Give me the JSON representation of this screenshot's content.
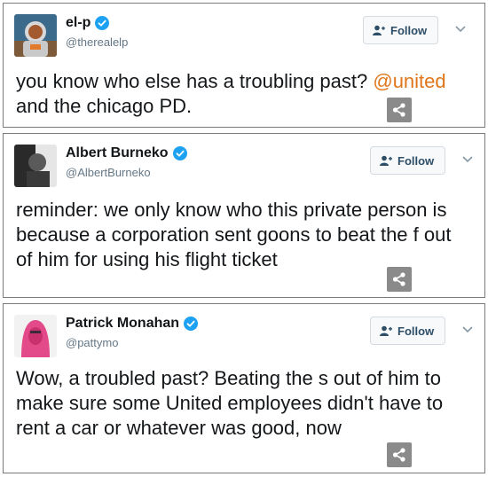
{
  "follow_label": "Follow",
  "colors": {
    "mention": "#e0751a",
    "handle": "#657786",
    "verified": "#1da1f2",
    "share_bg": "#8a8a8a"
  },
  "tweets": [
    {
      "name": "el-p",
      "handle": "@therealelp",
      "text_before": "you know who else has a troubling past? ",
      "mention": "@united",
      "text_after": " and the chicago PD.",
      "avatar_icon": "astronaut-avatar-icon"
    },
    {
      "name": "Albert Burneko",
      "handle": "@AlbertBurneko",
      "text_before": "reminder: we only know who this private person is because a corporation sent goons to beat the f      out of him for using his flight ticket",
      "mention": "",
      "text_after": "",
      "avatar_icon": "portrait-avatar-icon"
    },
    {
      "name": "Patrick Monahan",
      "handle": "@pattymo",
      "text_before": "Wow, a troubled past? Beating the s      out of him to make sure some United employees didn't have to rent a car or whatever was good, now",
      "mention": "",
      "text_after": "",
      "avatar_icon": "pink-hood-avatar-icon"
    }
  ]
}
